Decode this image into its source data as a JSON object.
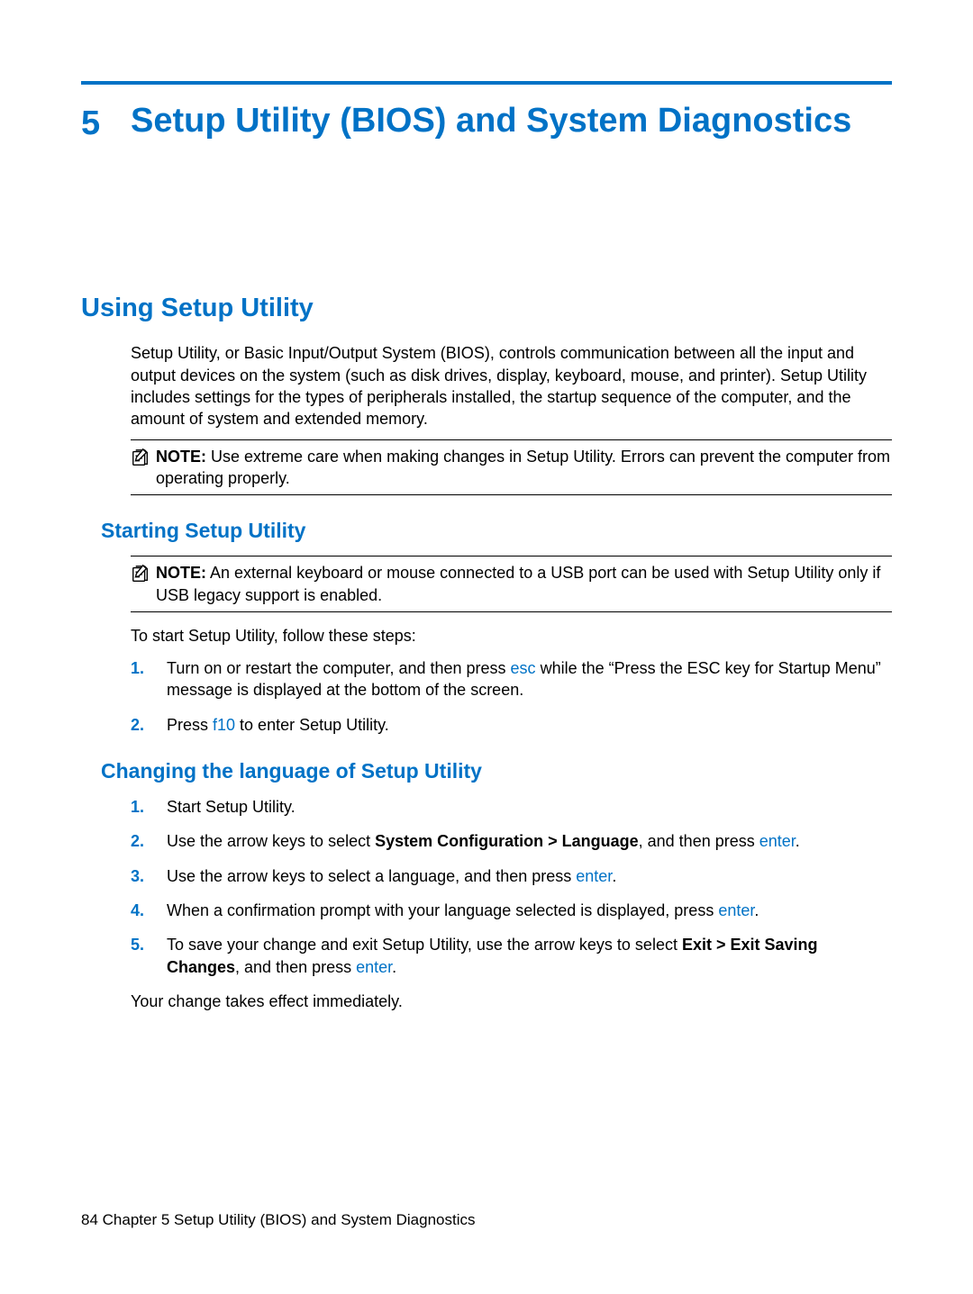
{
  "chapter": {
    "number": "5",
    "title": "Setup Utility (BIOS) and System Diagnostics"
  },
  "section1": {
    "heading": "Using Setup Utility",
    "intro": "Setup Utility, or Basic Input/Output System (BIOS), controls communication between all the input and output devices on the system (such as disk drives, display, keyboard, mouse, and printer). Setup Utility includes settings for the types of peripherals installed, the startup sequence of the computer, and the amount of system and extended memory.",
    "note1": {
      "label": "NOTE:",
      "text": "   Use extreme care when making changes in Setup Utility. Errors can prevent the computer from operating properly."
    }
  },
  "section2": {
    "heading": "Starting Setup Utility",
    "note": {
      "label": "NOTE:",
      "text": "   An external keyboard or mouse connected to a USB port can be used with Setup Utility only if USB legacy support is enabled."
    },
    "lead": "To start Setup Utility, follow these steps:",
    "steps": [
      {
        "num": "1.",
        "pre": "Turn on or restart the computer, and then press ",
        "key": "esc",
        "post": " while the “Press the ESC key for Startup Menu” message is displayed at the bottom of the screen."
      },
      {
        "num": "2.",
        "pre": "Press ",
        "key": "f10",
        "post": " to enter Setup Utility."
      }
    ]
  },
  "section3": {
    "heading": "Changing the language of Setup Utility",
    "steps": {
      "s1": {
        "num": "1.",
        "text": "Start Setup Utility."
      },
      "s2": {
        "num": "2.",
        "pre": "Use the arrow keys to select ",
        "bold": "System Configuration > Language",
        "mid": ", and then press ",
        "key": "enter",
        "post": "."
      },
      "s3": {
        "num": "3.",
        "pre": "Use the arrow keys to select a language, and then press ",
        "key": "enter",
        "post": "."
      },
      "s4": {
        "num": "4.",
        "pre": "When a confirmation prompt with your language selected is displayed, press ",
        "key": "enter",
        "post": "."
      },
      "s5": {
        "num": "5.",
        "pre": "To save your change and exit Setup Utility, use the arrow keys to select ",
        "bold": "Exit > Exit Saving Changes",
        "mid": ", and then press ",
        "key": "enter",
        "post": "."
      }
    },
    "tail": "Your change takes effect immediately."
  },
  "footer": {
    "page": "84",
    "chapter": "   Chapter 5   Setup Utility (BIOS) and System Diagnostics"
  }
}
